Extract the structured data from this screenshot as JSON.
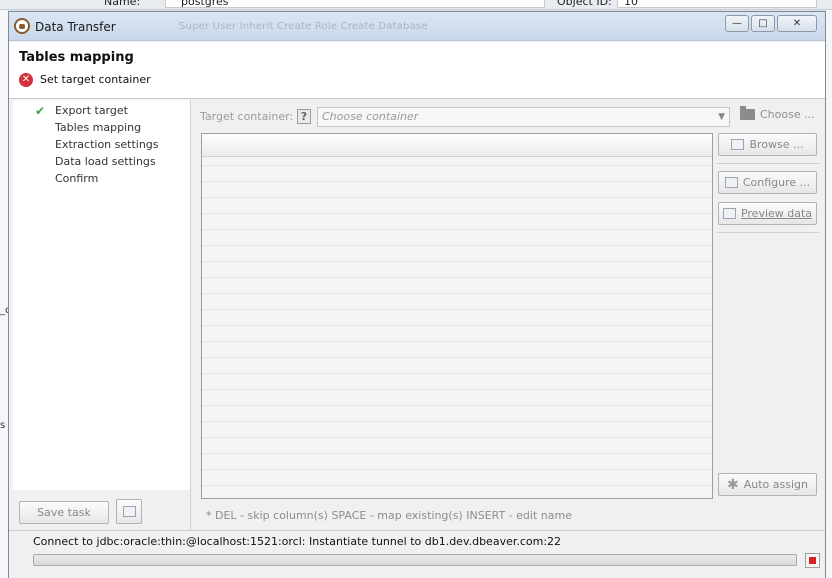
{
  "background": {
    "name_label": "Name:",
    "name_value": "postgres",
    "object_id_label": "Object ID:",
    "object_id_value": "10"
  },
  "window": {
    "title": "Data Transfer",
    "background_toolbar": "Super User   Inherit   Create Role   Create Database"
  },
  "header": {
    "title": "Tables mapping",
    "message": "Set target container"
  },
  "steps": [
    {
      "label": "Export target",
      "done": true
    },
    {
      "label": "Tables mapping",
      "done": false
    },
    {
      "label": "Extraction settings",
      "done": false
    },
    {
      "label": "Data load settings",
      "done": false
    },
    {
      "label": "Confirm",
      "done": false
    }
  ],
  "target": {
    "label": "Target container:",
    "placeholder": "Choose container",
    "choose_label": "Choose ..."
  },
  "buttons": {
    "browse": "Browse ...",
    "configure": "Configure ...",
    "preview": "Preview data",
    "auto_assign": "Auto assign",
    "save_task": "Save task"
  },
  "hint": "* DEL - skip column(s)  SPACE - map existing(s)  INSERT - edit name",
  "status": "Connect to jdbc:oracle:thin:@localhost:1521:orcl: Instantiate tunnel to db1.dev.dbeaver.com:22",
  "colors": {
    "error": "#d2333a",
    "check": "#3aa43f",
    "stop": "#d62424"
  }
}
